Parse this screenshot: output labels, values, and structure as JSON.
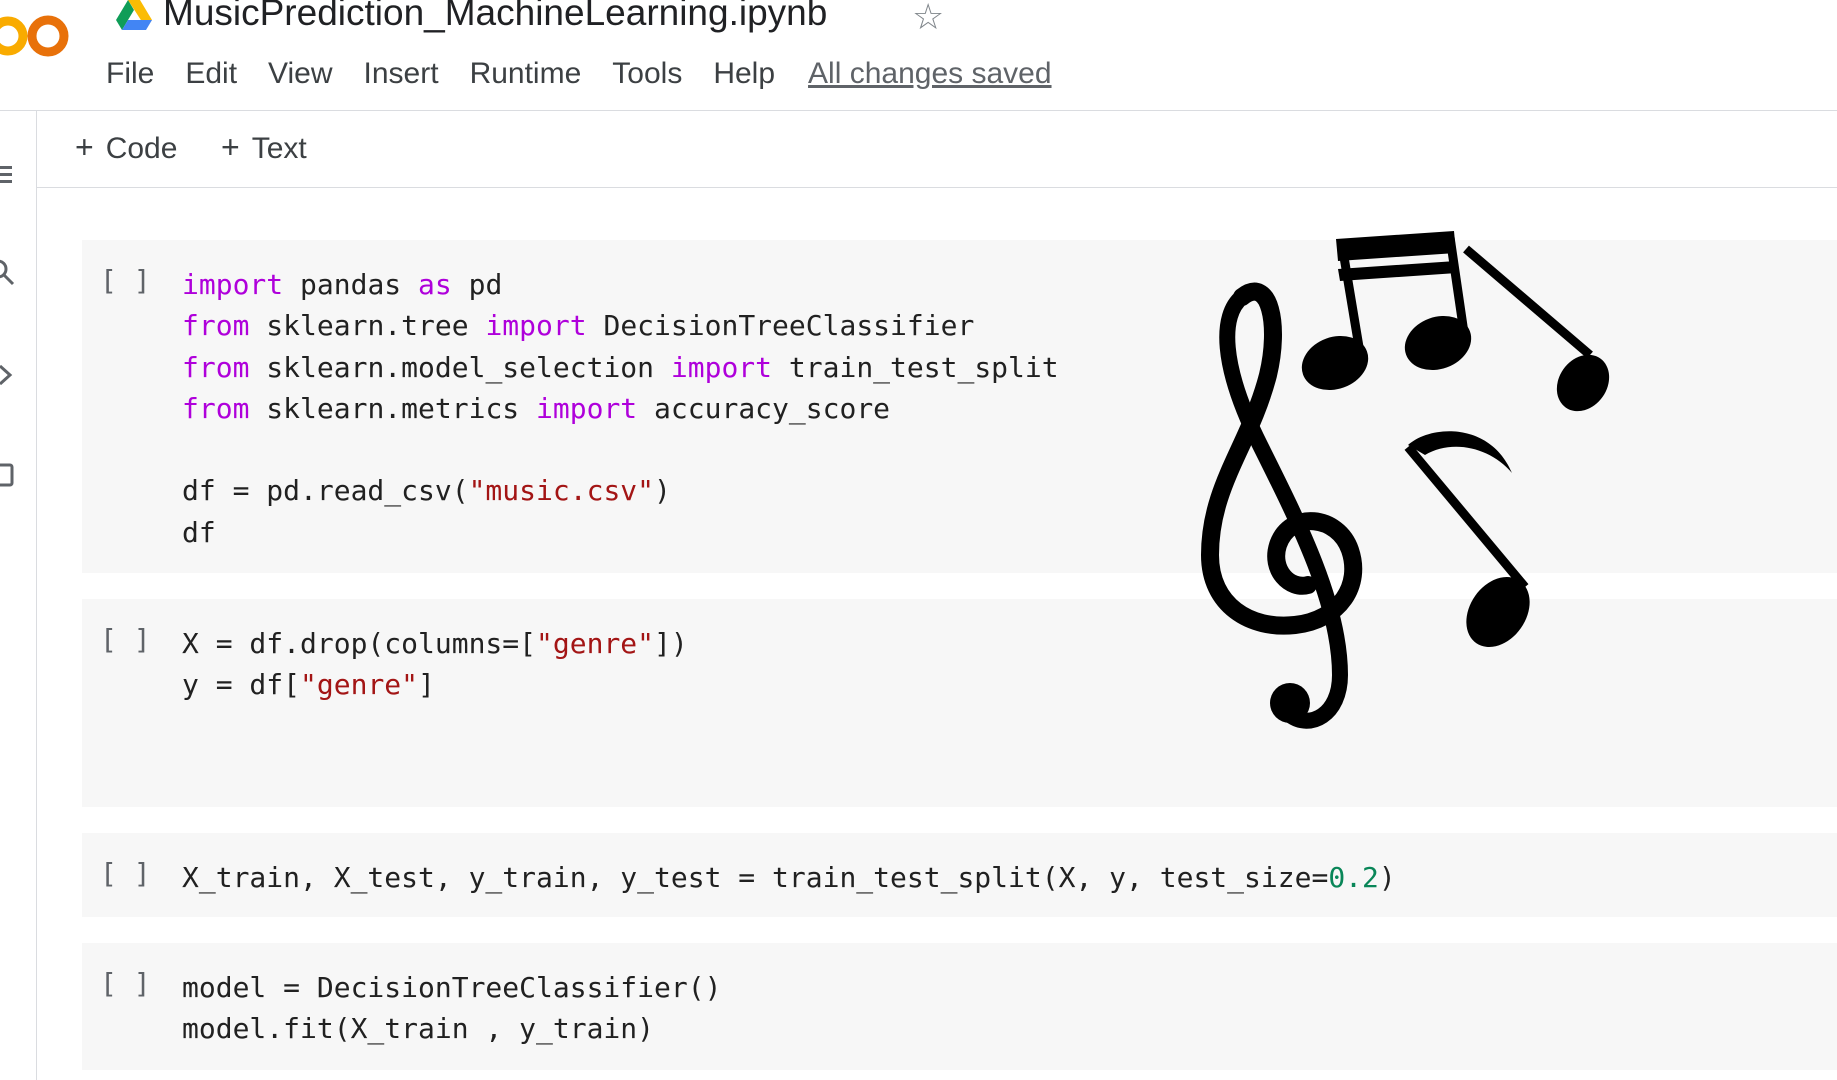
{
  "app": {
    "logo_text": "CO",
    "title": "MusicPrediction_MachineLearning.ipynb",
    "star_icon": "star-icon"
  },
  "menu": {
    "items": [
      "File",
      "Edit",
      "View",
      "Insert",
      "Runtime",
      "Tools",
      "Help"
    ],
    "status": "All changes saved"
  },
  "toolbar": {
    "add_code": "Code",
    "add_text": "Text"
  },
  "sidebar": {
    "icons": [
      "menu-icon",
      "search-icon",
      "code-snippets-icon",
      "files-icon"
    ]
  },
  "cells": [
    {
      "run_label": "[ ]",
      "lines": [
        [
          [
            "kw",
            "import"
          ],
          [
            "t",
            " pandas "
          ],
          [
            "kw",
            "as"
          ],
          [
            "t",
            " pd"
          ]
        ],
        [
          [
            "kw",
            "from"
          ],
          [
            "t",
            " sklearn.tree "
          ],
          [
            "kw",
            "import"
          ],
          [
            "t",
            " DecisionTreeClassifier"
          ]
        ],
        [
          [
            "kw",
            "from"
          ],
          [
            "t",
            " sklearn.model_selection "
          ],
          [
            "kw",
            "import"
          ],
          [
            "t",
            " train_test_split"
          ]
        ],
        [
          [
            "kw",
            "from"
          ],
          [
            "t",
            " sklearn.metrics "
          ],
          [
            "kw",
            "import"
          ],
          [
            "t",
            " accuracy_score"
          ]
        ],
        [],
        [
          [
            "t",
            "df = pd.read_csv("
          ],
          [
            "str",
            "\"music.csv\""
          ],
          [
            "t",
            ")"
          ]
        ],
        [
          [
            "t",
            "df"
          ]
        ]
      ]
    },
    {
      "run_label": "[ ]",
      "lines": [
        [
          [
            "t",
            "X = df.drop(columns=["
          ],
          [
            "str",
            "\"genre\""
          ],
          [
            "t",
            "])"
          ]
        ],
        [
          [
            "t",
            "y = df["
          ],
          [
            "str",
            "\"genre\""
          ],
          [
            "t",
            "]"
          ]
        ]
      ]
    },
    {
      "run_label": "[ ]",
      "lines": [
        [
          [
            "t",
            "X_train, X_test, y_train, y_test = train_test_split(X, y, test_size="
          ],
          [
            "num",
            "0.2"
          ],
          [
            "t",
            ")"
          ]
        ]
      ]
    },
    {
      "run_label": "[ ]",
      "lines": [
        [
          [
            "t",
            "model = DecisionTreeClassifier()"
          ]
        ],
        [
          [
            "t",
            "model.fit(X_train , y_train)"
          ]
        ]
      ]
    }
  ],
  "colors": {
    "keyword": "#af00db",
    "string": "#a31515",
    "number": "#098658",
    "cell_bg": "#f7f7f7",
    "logo_orange": "#f9ab00"
  }
}
